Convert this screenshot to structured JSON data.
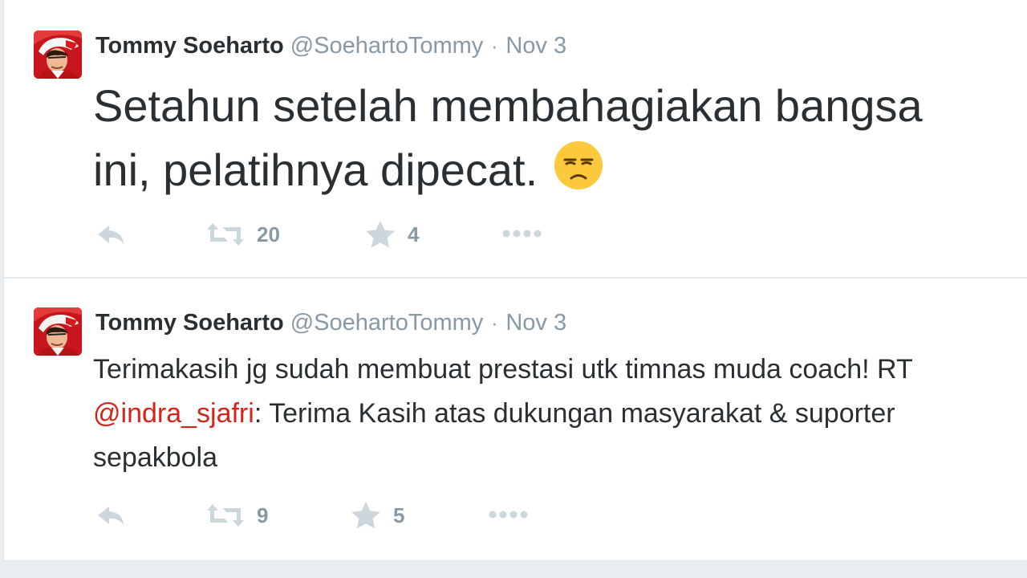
{
  "tweets": [
    {
      "fullname": "Tommy Soeharto",
      "username": "@SoehartoTommy",
      "separator": "·",
      "time": "Nov 3",
      "text_line1": "Setahun setelah membahagiakan bangsa",
      "text_line2": "ini, pelatihnya dipecat.",
      "emoji": "unamused-face-icon",
      "retweets": "20",
      "favorites": "4"
    },
    {
      "fullname": "Tommy Soeharto",
      "username": "@SoehartoTommy",
      "separator": "·",
      "time": "Nov 3",
      "text_line1": "Terimakasih jg sudah membuat prestasi utk timnas muda coach! RT",
      "mention": "@indra_sjafri",
      "text_line2_rest": ": Terima Kasih atas dukungan masyarakat & suporter",
      "text_line3": "sepakbola",
      "retweets": "9",
      "favorites": "5"
    }
  ],
  "icons": [
    "reply-icon",
    "retweet-icon",
    "favorite-star-icon",
    "more-options-icon"
  ],
  "colors": {
    "name": "#292f33",
    "meta": "#8899a6",
    "mention": "#d4241b",
    "action_icon": "#ccd6dd",
    "avatar_bg": "#c8141c"
  }
}
